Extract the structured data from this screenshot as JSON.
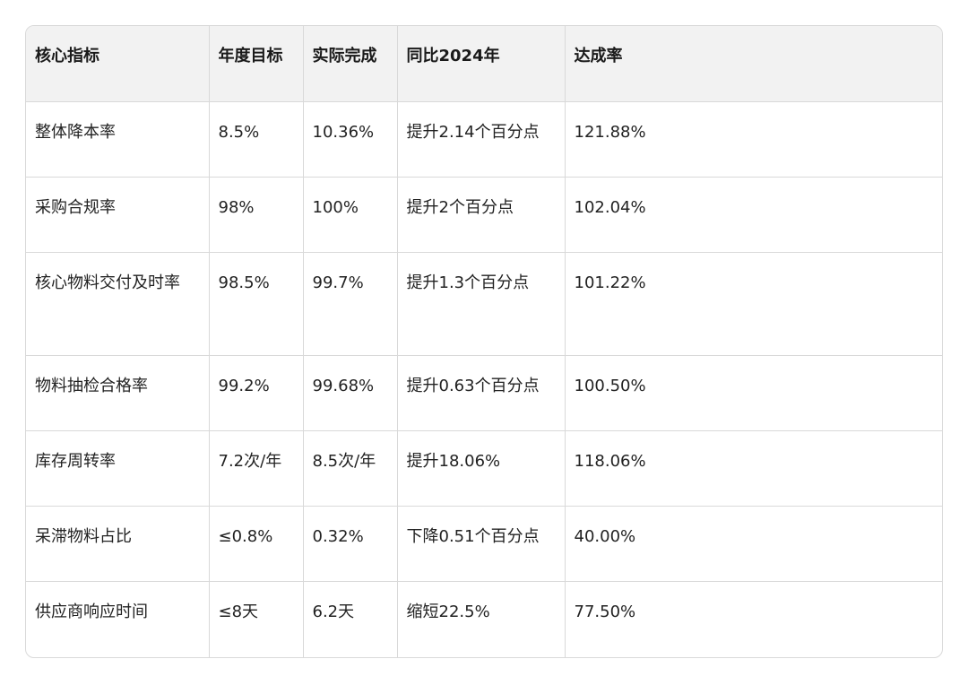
{
  "table": {
    "headers": [
      "核心指标",
      "年度目标",
      "实际完成",
      "同比2024年",
      "达成率"
    ],
    "rows": [
      [
        "整体降本率",
        "8.5%",
        "10.36%",
        "提升2.14个百分点",
        "121.88%"
      ],
      [
        "采购合规率",
        "98%",
        "100%",
        "提升2个百分点",
        "102.04%"
      ],
      [
        "核心物料交付及时率",
        "98.5%",
        "99.7%",
        "提升1.3个百分点",
        "101.22%"
      ],
      [
        "物料抽检合格率",
        "99.2%",
        "99.68%",
        "提升0.63个百分点",
        "100.50%"
      ],
      [
        "库存周转率",
        "7.2次/年",
        "8.5次/年",
        "提升18.06%",
        "118.06%"
      ],
      [
        "呆滞物料占比",
        "≤0.8%",
        "0.32%",
        "下降0.51个百分点",
        "40.00%"
      ],
      [
        "供应商响应时间",
        "≤8天",
        "6.2天",
        "缩短22.5%",
        "77.50%"
      ]
    ]
  }
}
